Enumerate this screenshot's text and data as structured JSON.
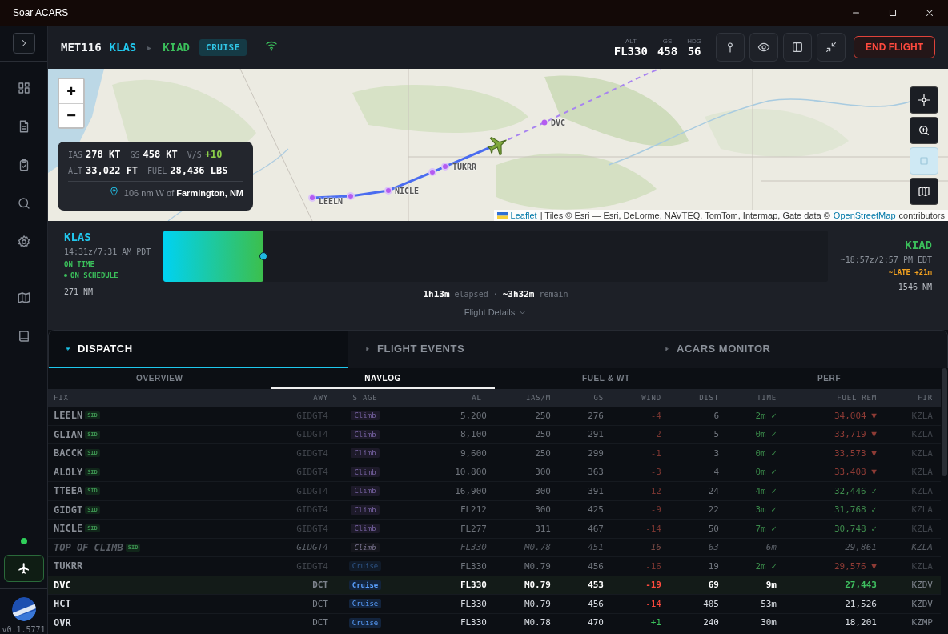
{
  "window": {
    "title": "Soar ACARS"
  },
  "sidebar": {
    "version": "v0.1.5771"
  },
  "header": {
    "callsign": "MET116",
    "origin": "KLAS",
    "separator": "▸",
    "destination": "KIAD",
    "phase": "CRUISE",
    "end_button": "END FLIGHT",
    "stats": [
      {
        "label": "ALT",
        "value": "FL330"
      },
      {
        "label": "GS",
        "value": "458"
      },
      {
        "label": "HDG",
        "value": "56"
      }
    ]
  },
  "map": {
    "zoom_in": "+",
    "zoom_out": "−",
    "waypoints": [
      {
        "name": "LEELN"
      },
      {
        "name": "NICLE"
      },
      {
        "name": "TUKRR"
      },
      {
        "name": "DVC"
      }
    ],
    "telemetry": [
      {
        "label": "IAS",
        "value": "278 KT",
        "positive": false
      },
      {
        "label": "GS",
        "value": "458 KT",
        "positive": false
      },
      {
        "label": "V/S",
        "value": "+10",
        "positive": true
      },
      {
        "label": "ALT",
        "value": "33,022 FT",
        "positive": false
      },
      {
        "label": "FUEL",
        "value": "28,436 LBS",
        "positive": false
      }
    ],
    "location": "106 nm W of **Farmington, NM**",
    "layers_selected": true,
    "attribution": {
      "link": "Leaflet",
      "text": "| Tiles © Esri — Esri, DeLorme, NAVTEQ, TomTom, Intermap, Gate data ©",
      "link2": "OpenStreetMap",
      "suffix": "contributors"
    }
  },
  "progress": {
    "origin": {
      "code": "KLAS",
      "time": "14:31z/7:31 AM PDT",
      "status": "ON TIME",
      "schedule": "ON SCHEDULE",
      "distance": "271 NM"
    },
    "destination": {
      "code": "KIAD",
      "time": "~18:57z/2:57 PM EDT",
      "status": "~LATE +21m",
      "distance": "1546 NM"
    },
    "level": 0.15,
    "elapsed": "1h13m",
    "elapsed_label": "elapsed",
    "dot": "·",
    "remain": "~3h32m",
    "remain_label": "remain",
    "details": "Flight Details"
  },
  "tabs": [
    {
      "label": "DISPATCH",
      "selected": true
    },
    {
      "label": "FLIGHT EVENTS",
      "selected": false
    },
    {
      "label": "ACARS MONITOR",
      "selected": false
    }
  ],
  "subtabs": [
    {
      "label": "OVERVIEW",
      "selected": false
    },
    {
      "label": "NAVLOG",
      "selected": true
    },
    {
      "label": "FUEL & WT",
      "selected": false
    },
    {
      "label": "PERF",
      "selected": false
    }
  ],
  "table": {
    "columns": [
      "FIX",
      "AWY",
      "STAGE",
      "ALT",
      "IAS/M",
      "GS",
      "WIND",
      "DIST",
      "TIME",
      "FUEL REM",
      "FIR"
    ],
    "rows": [
      {
        "passed": true,
        "computed": false,
        "current": false,
        "fix": "LEELN",
        "tag": "SID",
        "awy": "GIDGT4",
        "stage": "Climb",
        "climbing": true,
        "alt": "5,200",
        "ias": "250",
        "gs": "276",
        "wind": "-4",
        "headwind": true,
        "dist": "6",
        "time": "2m",
        "time_mark": "✓",
        "fuel": "34,004",
        "fuel_mark": "▼",
        "fuel_below_plan": true,
        "fuel_on_plan": false,
        "fir": "KZLA"
      },
      {
        "passed": true,
        "computed": false,
        "current": false,
        "fix": "GLIAN",
        "tag": "SID",
        "awy": "GIDGT4",
        "stage": "Climb",
        "climbing": true,
        "alt": "8,100",
        "ias": "250",
        "gs": "291",
        "wind": "-2",
        "headwind": true,
        "dist": "5",
        "time": "0m",
        "time_mark": "✓",
        "fuel": "33,719",
        "fuel_mark": "▼",
        "fuel_below_plan": true,
        "fuel_on_plan": false,
        "fir": "KZLA"
      },
      {
        "passed": true,
        "computed": false,
        "current": false,
        "fix": "BACCK",
        "tag": "SID",
        "awy": "GIDGT4",
        "stage": "Climb",
        "climbing": true,
        "alt": "9,600",
        "ias": "250",
        "gs": "299",
        "wind": "-1",
        "headwind": true,
        "dist": "3",
        "time": "0m",
        "time_mark": "✓",
        "fuel": "33,573",
        "fuel_mark": "▼",
        "fuel_below_plan": true,
        "fuel_on_plan": false,
        "fir": "KZLA"
      },
      {
        "passed": true,
        "computed": false,
        "current": false,
        "fix": "ALOLY",
        "tag": "SID",
        "awy": "GIDGT4",
        "stage": "Climb",
        "climbing": true,
        "alt": "10,800",
        "ias": "300",
        "gs": "363",
        "wind": "-3",
        "headwind": true,
        "dist": "4",
        "time": "0m",
        "time_mark": "✓",
        "fuel": "33,408",
        "fuel_mark": "▼",
        "fuel_below_plan": true,
        "fuel_on_plan": false,
        "fir": "KZLA"
      },
      {
        "passed": true,
        "computed": false,
        "current": false,
        "fix": "TTEEA",
        "tag": "SID",
        "awy": "GIDGT4",
        "stage": "Climb",
        "climbing": true,
        "alt": "16,900",
        "ias": "300",
        "gs": "391",
        "wind": "-12",
        "headwind": true,
        "dist": "24",
        "time": "4m",
        "time_mark": "✓",
        "fuel": "32,446",
        "fuel_mark": "✓",
        "fuel_below_plan": false,
        "fuel_on_plan": true,
        "fir": "KZLA"
      },
      {
        "passed": true,
        "computed": false,
        "current": false,
        "fix": "GIDGT",
        "tag": "SID",
        "awy": "GIDGT4",
        "stage": "Climb",
        "climbing": true,
        "alt": "FL212",
        "ias": "300",
        "gs": "425",
        "wind": "-9",
        "headwind": true,
        "dist": "22",
        "time": "3m",
        "time_mark": "✓",
        "fuel": "31,768",
        "fuel_mark": "✓",
        "fuel_below_plan": false,
        "fuel_on_plan": true,
        "fir": "KZLA"
      },
      {
        "passed": true,
        "computed": false,
        "current": false,
        "fix": "NICLE",
        "tag": "SID",
        "awy": "GIDGT4",
        "stage": "Climb",
        "climbing": true,
        "alt": "FL277",
        "ias": "311",
        "gs": "467",
        "wind": "-14",
        "headwind": true,
        "dist": "50",
        "time": "7m",
        "time_mark": "✓",
        "fuel": "30,748",
        "fuel_mark": "✓",
        "fuel_below_plan": false,
        "fuel_on_plan": true,
        "fir": "KZLA"
      },
      {
        "passed": false,
        "computed": true,
        "current": false,
        "fix": "TOP OF CLIMB",
        "tag": "SID",
        "awy": "GIDGT4",
        "stage": "Climb",
        "climbing": true,
        "alt": "FL330",
        "ias": "M0.78",
        "gs": "451",
        "wind": "-16",
        "headwind": true,
        "dist": "63",
        "time": "6m",
        "fuel": "29,861",
        "fuel_below_plan": false,
        "fuel_on_plan": false,
        "fir": "KZLA"
      },
      {
        "passed": true,
        "computed": false,
        "current": false,
        "fix": "TUKRR",
        "awy": "GIDGT4",
        "stage": "Cruise",
        "climbing": false,
        "alt": "FL330",
        "ias": "M0.79",
        "gs": "456",
        "wind": "-16",
        "headwind": true,
        "dist": "19",
        "time": "2m",
        "time_mark": "✓",
        "fuel": "29,576",
        "fuel_mark": "▼",
        "fuel_below_plan": true,
        "fuel_on_plan": false,
        "fir": "KZLA"
      },
      {
        "passed": false,
        "computed": false,
        "current": true,
        "fix": "DVC",
        "awy": "DCT",
        "stage": "Cruise",
        "climbing": false,
        "alt": "FL330",
        "ias": "M0.79",
        "gs": "453",
        "wind": "-19",
        "headwind": true,
        "dist": "69",
        "time": "9m",
        "fuel": "27,443",
        "fuel_below_plan": false,
        "fuel_on_plan": true,
        "fir": "KZDV"
      },
      {
        "passed": false,
        "computed": false,
        "current": false,
        "fix": "HCT",
        "awy": "DCT",
        "stage": "Cruise",
        "climbing": false,
        "alt": "FL330",
        "ias": "M0.79",
        "gs": "456",
        "wind": "-14",
        "headwind": true,
        "dist": "405",
        "time": "53m",
        "fuel": "21,526",
        "fuel_below_plan": false,
        "fuel_on_plan": false,
        "fir": "KZDV"
      },
      {
        "passed": false,
        "computed": false,
        "current": false,
        "fix": "OVR",
        "awy": "DCT",
        "stage": "Cruise",
        "climbing": false,
        "alt": "FL330",
        "ias": "M0.78",
        "gs": "470",
        "wind": "+1",
        "headwind": false,
        "dist": "240",
        "time": "30m",
        "fuel": "18,201",
        "fuel_below_plan": false,
        "fuel_on_plan": false,
        "fir": "KZMP"
      }
    ]
  }
}
